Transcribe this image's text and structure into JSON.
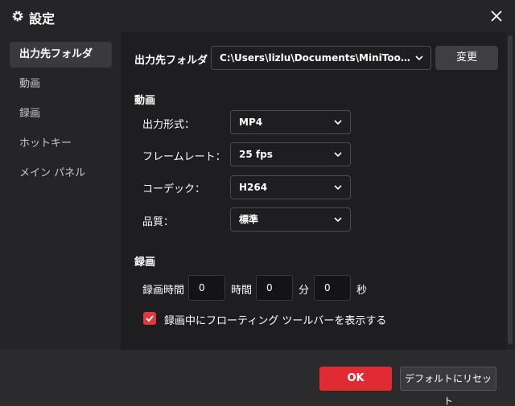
{
  "window": {
    "title": "設定",
    "icon": "gear-icon",
    "close_icon": "close-icon"
  },
  "sidebar": {
    "items": [
      {
        "label": "出力先フォルダ",
        "active": true
      },
      {
        "label": "動画",
        "active": false
      },
      {
        "label": "録画",
        "active": false
      },
      {
        "label": "ホットキー",
        "active": false
      },
      {
        "label": "メイン パネル",
        "active": false
      }
    ]
  },
  "output_folder": {
    "label": "出力先フォルダ",
    "path": "C:\\Users\\lizlu\\Documents\\MiniTool Vi...",
    "change_button": "変更"
  },
  "video": {
    "section_title": "動画",
    "format_label": "出力形式：",
    "format_value": "MP4",
    "framerate_label": "フレームレート：",
    "framerate_value": "25 fps",
    "codec_label": "コーデック：",
    "codec_value": "H264",
    "quality_label": "品質：",
    "quality_value": "標準"
  },
  "recording": {
    "section_title": "録画",
    "duration_label": "録画時間",
    "hours_value": "0",
    "hours_unit": "時間",
    "minutes_value": "0",
    "minutes_unit": "分",
    "seconds_value": "0",
    "seconds_unit": "秒",
    "floating_toolbar_label": "録画中にフローティング ツールバーを表示する",
    "floating_toolbar_checked": true
  },
  "footer": {
    "ok_button": "OK",
    "reset_button": "デフォルトにリセット"
  },
  "colors": {
    "accent": "#e02b35",
    "checkbox": "#e03a3e",
    "panel": "#1e1e20",
    "sidebar": "#252527"
  }
}
